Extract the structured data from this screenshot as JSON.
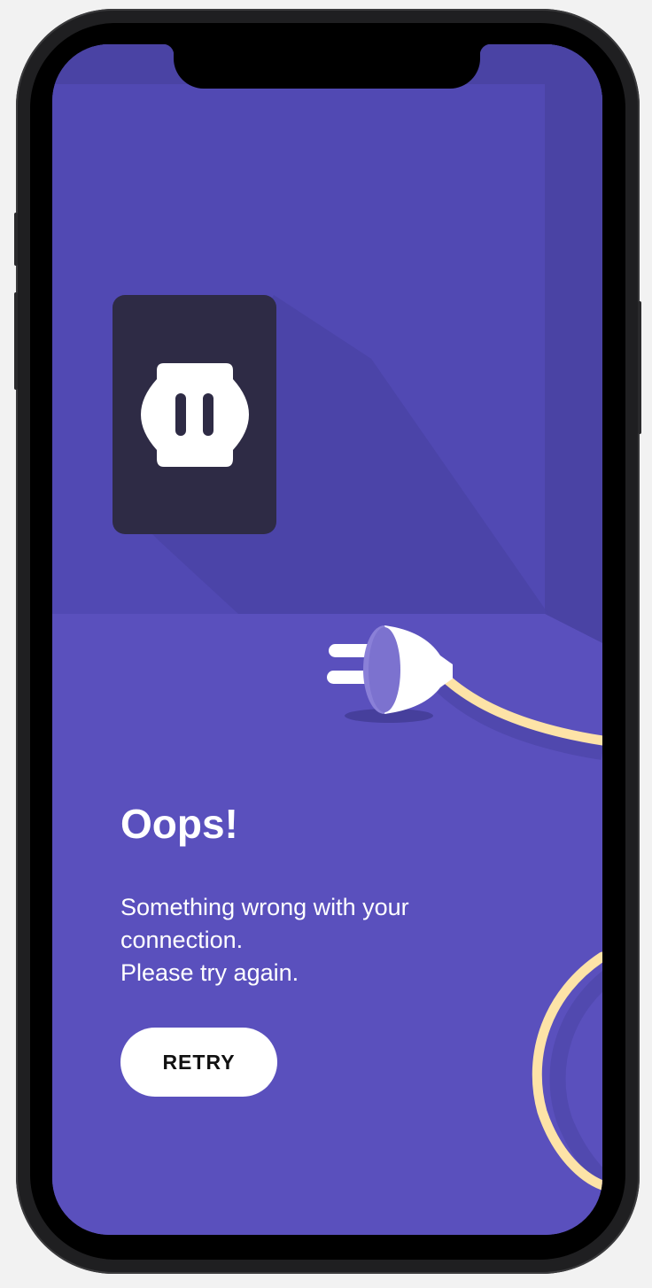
{
  "error_screen": {
    "title": "Oops!",
    "message_lines": [
      "Something wrong with your",
      "connection.",
      "Please try again."
    ],
    "retry_label": "RETRY"
  },
  "colors": {
    "wall": "#5149b3",
    "floor": "#5a50bd",
    "socket_plate": "#2e2b45",
    "plug": "#ffffff",
    "cable": "#fde3a7",
    "button_bg": "#ffffff"
  },
  "icons": {
    "socket": "power-socket-icon",
    "plug": "unplugged-plug-icon"
  }
}
